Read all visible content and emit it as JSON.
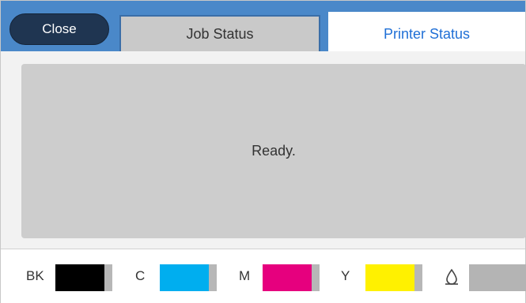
{
  "header": {
    "close_label": "Close",
    "tabs": [
      {
        "label": "Job Status",
        "selected": false
      },
      {
        "label": "Printer Status",
        "selected": true
      }
    ]
  },
  "status": {
    "message": "Ready."
  },
  "inks": [
    {
      "label": "BK",
      "color": "#000000",
      "level": 0.86
    },
    {
      "label": "C",
      "color": "#00aeef",
      "level": 0.86
    },
    {
      "label": "M",
      "color": "#e6007e",
      "level": 0.86
    },
    {
      "label": "Y",
      "color": "#fff100",
      "level": 0.86
    }
  ],
  "maintenance_box": {
    "icon": "maintenance-box-icon",
    "color": "#b4b4b4",
    "level": 0
  },
  "colors": {
    "header_bar": "#4a88c9",
    "close_button": "#1f3551",
    "active_tab_text": "#1f6fd6",
    "status_panel": "#cdcdcd"
  }
}
